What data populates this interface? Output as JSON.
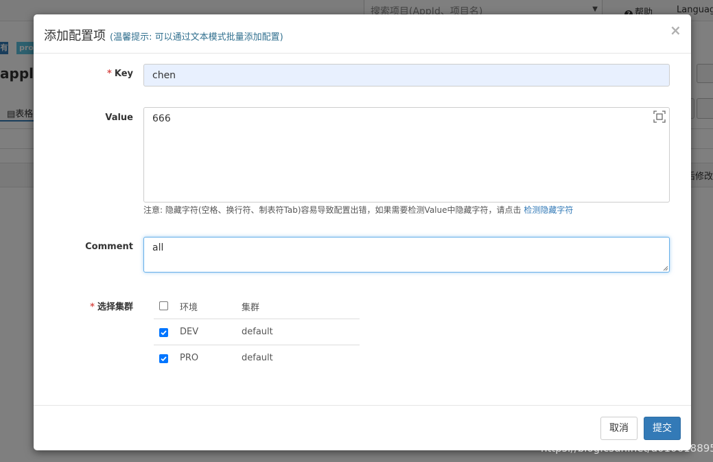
{
  "background": {
    "search_placeholder": "搜索项目(AppId、项目名)",
    "help_label": "帮助",
    "language_label": "Languag",
    "badge_left": "有",
    "badge_right": "pro",
    "app_title": "applic",
    "tab_label": "表格",
    "modified_label": "后修改"
  },
  "modal": {
    "title": "添加配置项",
    "subtitle": "(温馨提示: 可以通过文本模式批量添加配置)",
    "key": {
      "label": "Key",
      "value": "chen"
    },
    "value": {
      "label": "Value",
      "value": "666",
      "note": "注意: 隐藏字符(空格、换行符、制表符Tab)容易导致配置出错，如果需要检测Value中隐藏字符，请点击",
      "note_link": "检测隐藏字符"
    },
    "comment": {
      "label": "Comment",
      "value": "all"
    },
    "clusters": {
      "label": "选择集群",
      "header": {
        "env": "环境",
        "cluster": "集群",
        "checked": false
      },
      "rows": [
        {
          "env": "DEV",
          "cluster": "default",
          "checked": true
        },
        {
          "env": "PRO",
          "cluster": "default",
          "checked": true
        }
      ]
    },
    "footer": {
      "cancel_label": "取消",
      "submit_label": "提交"
    }
  },
  "watermark": "https://blog.csdn.net/u010618895",
  "colors": {
    "primary": "#337ab7",
    "required": "#d9534f",
    "checkbox": "#0075ff",
    "subtitle": "#31708f"
  }
}
